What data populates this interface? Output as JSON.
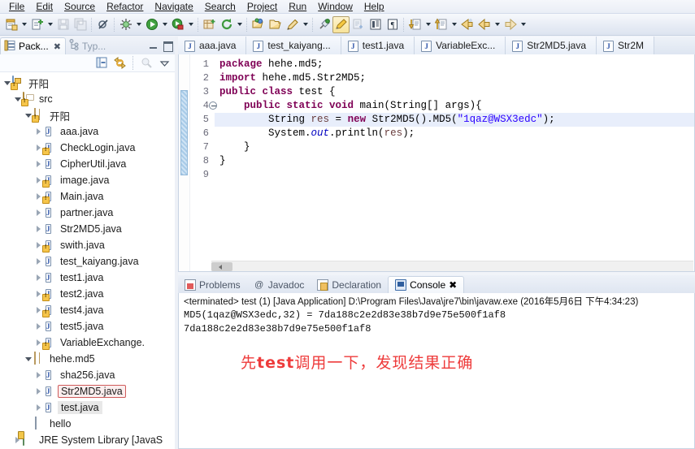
{
  "menubar": {
    "items": [
      {
        "label": "File",
        "accel": "F"
      },
      {
        "label": "Edit",
        "accel": "E"
      },
      {
        "label": "Source",
        "accel": "S"
      },
      {
        "label": "Refactor",
        "accel": "t"
      },
      {
        "label": "Navigate",
        "accel": "N"
      },
      {
        "label": "Search",
        "accel": "a"
      },
      {
        "label": "Project",
        "accel": "P"
      },
      {
        "label": "Run",
        "accel": "R"
      },
      {
        "label": "Window",
        "accel": "W"
      },
      {
        "label": "Help",
        "accel": "H"
      }
    ]
  },
  "toolbar": {
    "buttons": [
      {
        "name": "new-icon",
        "dropdown": true
      },
      {
        "name": "new-java-file-icon",
        "dropdown": true
      },
      {
        "name": "save-icon",
        "dropdown": false
      },
      {
        "name": "save-all-icon",
        "dropdown": false
      },
      {
        "name": "toggle-breakpoint-icon",
        "dropdown": false
      },
      {
        "name": "debug-icon",
        "dropdown": true
      },
      {
        "name": "run-icon",
        "dropdown": true
      },
      {
        "name": "run-external-tools-icon",
        "dropdown": true
      },
      {
        "name": "new-java-package-icon",
        "dropdown": false
      },
      {
        "name": "refresh-icon",
        "dropdown": true
      },
      {
        "name": "open-type-icon",
        "dropdown": false
      },
      {
        "name": "open-resource-icon",
        "dropdown": false
      },
      {
        "name": "search-pencil-icon",
        "dropdown": true
      },
      {
        "name": "pin-editor-icon",
        "dropdown": false
      },
      {
        "name": "mark-occurrences-icon",
        "dropdown": false,
        "pressed": true
      },
      {
        "name": "next-annotation-icon",
        "dropdown": false
      },
      {
        "name": "show-whitespace-icon",
        "dropdown": false
      },
      {
        "name": "show-pilcrow-icon",
        "dropdown": false
      },
      {
        "name": "next-edit-icon",
        "dropdown": true
      },
      {
        "name": "previous-edit-icon",
        "dropdown": true
      },
      {
        "name": "back-icon",
        "dropdown": false
      },
      {
        "name": "back-nav-icon",
        "dropdown": true
      },
      {
        "name": "forward-nav-icon",
        "dropdown": true
      }
    ]
  },
  "explorer": {
    "tabs": [
      {
        "label": "Pack...",
        "active": true,
        "icon": "package-explorer-icon",
        "closable": true
      },
      {
        "label": "Typ...",
        "active": false,
        "icon": "type-hierarchy-icon",
        "closable": false
      }
    ],
    "window_controls": [
      "minimize-icon",
      "maximize-icon"
    ],
    "toolbar": [
      "collapse-all-icon",
      "link-with-editor-icon",
      "focus-on-active-task-icon",
      "view-menu-icon"
    ],
    "tree": [
      {
        "label": "开阳",
        "indent": 0,
        "twist": "open",
        "icon": "java-project-icon",
        "warn": true
      },
      {
        "label": "src",
        "indent": 1,
        "twist": "open",
        "icon": "source-folder-icon",
        "warn": true
      },
      {
        "label": "开阳",
        "indent": 2,
        "twist": "open",
        "icon": "package-icon",
        "warn": true
      },
      {
        "label": "aaa.java",
        "indent": 3,
        "twist": "closed",
        "icon": "java-file-icon",
        "warn": false
      },
      {
        "label": "CheckLogin.java",
        "indent": 3,
        "twist": "closed",
        "icon": "java-file-icon",
        "warn": true
      },
      {
        "label": "CipherUtil.java",
        "indent": 3,
        "twist": "closed",
        "icon": "java-file-icon",
        "warn": false
      },
      {
        "label": "image.java",
        "indent": 3,
        "twist": "closed",
        "icon": "java-file-icon",
        "warn": true
      },
      {
        "label": "Main.java",
        "indent": 3,
        "twist": "closed",
        "icon": "java-file-icon",
        "warn": true
      },
      {
        "label": "partner.java",
        "indent": 3,
        "twist": "closed",
        "icon": "java-file-icon",
        "warn": false
      },
      {
        "label": "Str2MD5.java",
        "indent": 3,
        "twist": "closed",
        "icon": "java-file-icon",
        "warn": false
      },
      {
        "label": "swith.java",
        "indent": 3,
        "twist": "closed",
        "icon": "java-file-icon",
        "warn": true
      },
      {
        "label": "test_kaiyang.java",
        "indent": 3,
        "twist": "closed",
        "icon": "java-file-icon",
        "warn": false
      },
      {
        "label": "test1.java",
        "indent": 3,
        "twist": "closed",
        "icon": "java-file-icon",
        "warn": false
      },
      {
        "label": "test2.java",
        "indent": 3,
        "twist": "closed",
        "icon": "java-file-icon",
        "warn": true
      },
      {
        "label": "test4.java",
        "indent": 3,
        "twist": "closed",
        "icon": "java-file-icon",
        "warn": true
      },
      {
        "label": "test5.java",
        "indent": 3,
        "twist": "closed",
        "icon": "java-file-icon",
        "warn": false
      },
      {
        "label": "VariableExchange.",
        "indent": 3,
        "twist": "closed",
        "icon": "java-file-icon",
        "warn": true
      },
      {
        "label": "hehe.md5",
        "indent": 2,
        "twist": "open",
        "icon": "package-icon",
        "warn": false
      },
      {
        "label": "sha256.java",
        "indent": 3,
        "twist": "closed",
        "icon": "java-file-icon",
        "warn": false
      },
      {
        "label": "Str2MD5.java",
        "indent": 3,
        "twist": "closed",
        "icon": "java-file-icon",
        "warn": false,
        "highlight": "red-box"
      },
      {
        "label": "test.java",
        "indent": 3,
        "twist": "closed",
        "icon": "java-file-icon",
        "warn": false,
        "highlight": "gray"
      },
      {
        "label": "hello",
        "indent": 2,
        "twist": "none",
        "icon": "file-icon",
        "warn": false
      },
      {
        "label": "JRE System Library [JavaS",
        "indent": 1,
        "twist": "closed",
        "icon": "jre-library-icon",
        "warn": false
      }
    ]
  },
  "editor": {
    "tabs": [
      {
        "label": "aaa.java",
        "active": false
      },
      {
        "label": "test_kaiyang...",
        "active": false
      },
      {
        "label": "test1.java",
        "active": false
      },
      {
        "label": "VariableExc...",
        "active": false
      },
      {
        "label": "Str2MD5.java",
        "active": false
      },
      {
        "label": "Str2M",
        "active": false
      }
    ],
    "line_numbers": [
      "1",
      "2",
      "3",
      "4",
      "5",
      "6",
      "7",
      "8",
      "9"
    ],
    "fold_line": 4,
    "highlight_line": 5,
    "lines": [
      [
        {
          "t": "package ",
          "c": "kw"
        },
        {
          "t": "hehe.md5;",
          "c": ""
        }
      ],
      [
        {
          "t": "import ",
          "c": "kw"
        },
        {
          "t": "hehe.md5.Str2MD5;",
          "c": ""
        }
      ],
      [
        {
          "t": "public class ",
          "c": "kw"
        },
        {
          "t": "test {",
          "c": ""
        }
      ],
      [
        {
          "t": "    ",
          "c": ""
        },
        {
          "t": "public static void ",
          "c": "kw"
        },
        {
          "t": "main(String[] args){",
          "c": ""
        }
      ],
      [
        {
          "t": "        String ",
          "c": ""
        },
        {
          "t": "res",
          "c": "loc"
        },
        {
          "t": " = ",
          "c": ""
        },
        {
          "t": "new ",
          "c": "kw"
        },
        {
          "t": "Str2MD5().MD5(",
          "c": ""
        },
        {
          "t": "\"1qaz@WSX3edc\"",
          "c": "str"
        },
        {
          "t": ");",
          "c": ""
        }
      ],
      [
        {
          "t": "        System.",
          "c": ""
        },
        {
          "t": "out",
          "c": "fld"
        },
        {
          "t": ".println(",
          "c": ""
        },
        {
          "t": "res",
          "c": "loc"
        },
        {
          "t": ");",
          "c": ""
        }
      ],
      [
        {
          "t": "    }",
          "c": ""
        }
      ],
      [
        {
          "t": "}",
          "c": ""
        }
      ],
      [
        {
          "t": "",
          "c": ""
        }
      ]
    ]
  },
  "console": {
    "tabs": [
      {
        "label": "Problems",
        "active": false,
        "icon": "problems-icon"
      },
      {
        "label": "Javadoc",
        "active": false,
        "icon": "javadoc-icon"
      },
      {
        "label": "Declaration",
        "active": false,
        "icon": "declaration-icon"
      },
      {
        "label": "Console",
        "active": true,
        "icon": "console-icon",
        "closable": true
      }
    ],
    "terminated_line": "<terminated> test (1) [Java Application] D:\\Program Files\\Java\\jre7\\bin\\javaw.exe (2016年5月6日 下午4:34:23)",
    "output_lines": [
      "MD5(1qaz@WSX3edc,32)  = 7da188c2e2d83e38b7d9e75e500f1af8",
      "7da188c2e2d83e38b7d9e75e500f1af8"
    ],
    "annotation": {
      "pre": "先",
      "bold": "test",
      "post": "调用一下，发现结果正确",
      "color": "#ee3b3b"
    }
  }
}
